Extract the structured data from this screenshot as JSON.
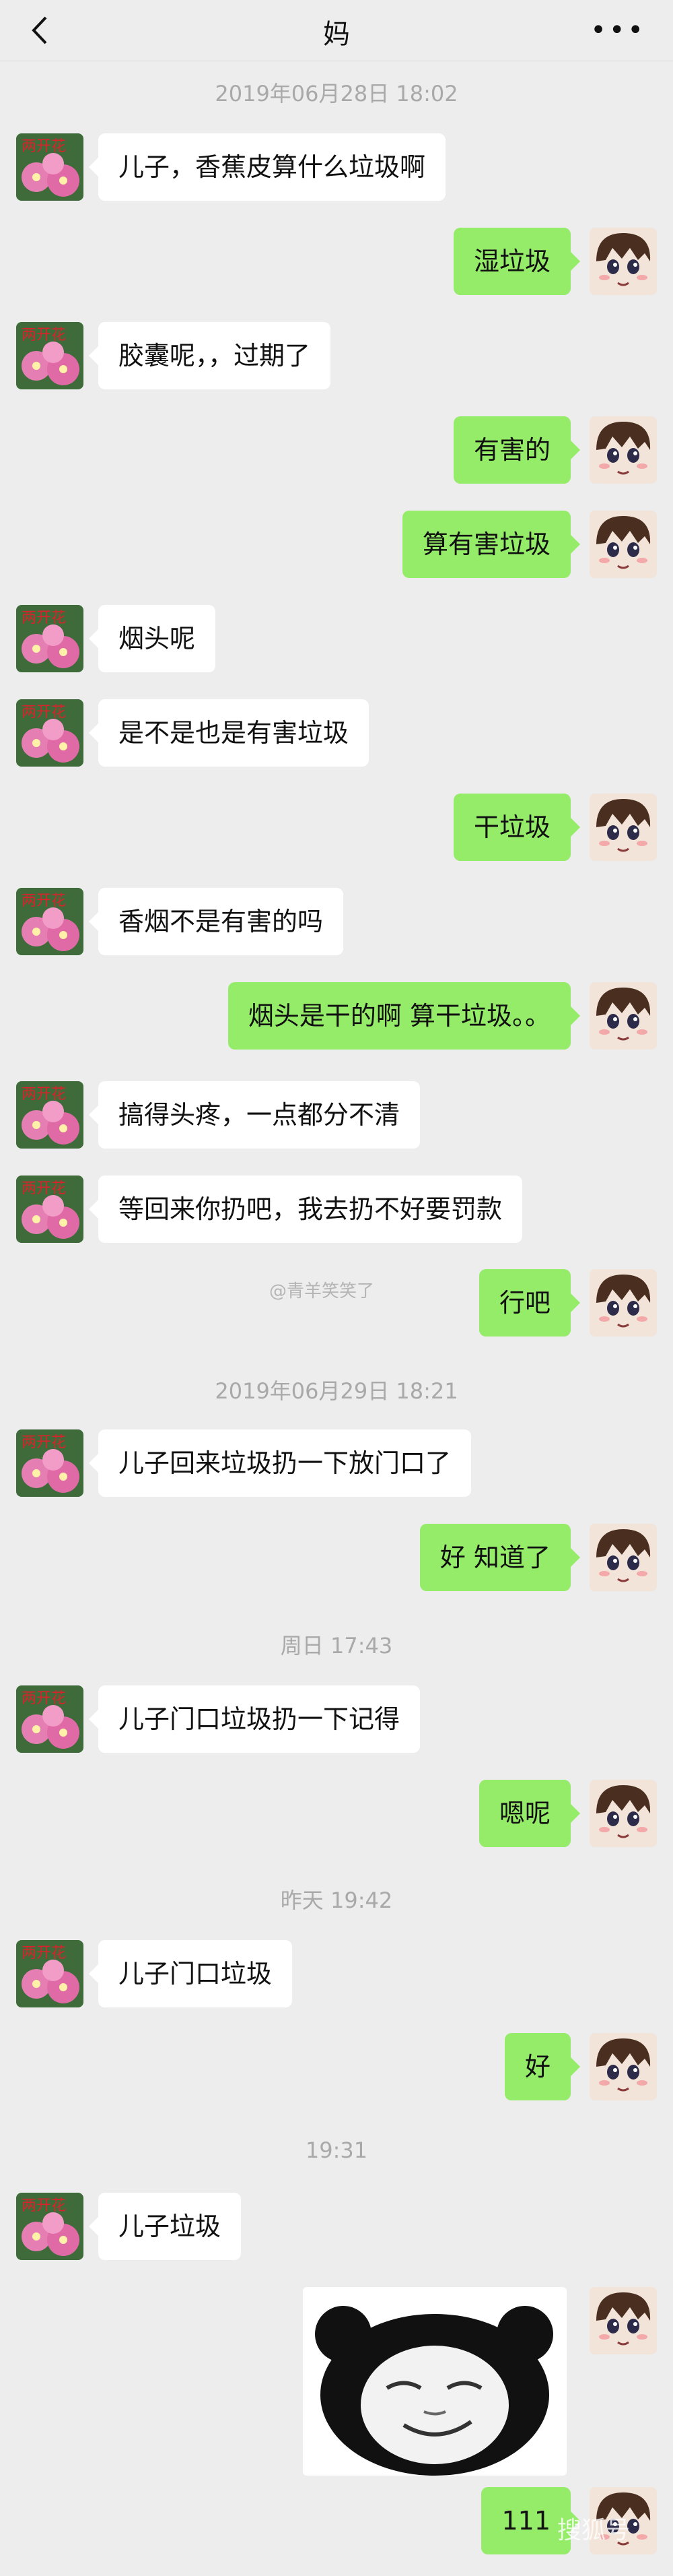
{
  "header": {
    "title": "妈"
  },
  "timestamps": [
    "2019年06月28日 18:02",
    "2019年06月29日 18:21",
    "周日 17:43",
    "昨天 19:42",
    "19:31"
  ],
  "messages": [
    "儿子，香蕉皮算什么垃圾啊",
    "湿垃圾",
    "胶囊呢，，过期了",
    "有害的",
    "算有害垃圾",
    "烟头呢",
    "是不是也是有害垃圾",
    "干垃圾",
    "香烟不是有害的吗",
    "烟头是干的啊 算干垃圾。。",
    "搞得头疼，一点都分不清",
    "等回来你扔吧，我去扔不好要罚款",
    "行吧",
    "儿子回来垃圾扔一下放门口了",
    "好  知道了",
    "儿子门口垃圾扔一下记得",
    "嗯呢",
    "儿子门口垃圾",
    "好",
    "儿子垃圾",
    "111"
  ],
  "watermark": "@青羊笑笑了",
  "avatar_caption": "两开花",
  "corner_mark": "搜狐号"
}
